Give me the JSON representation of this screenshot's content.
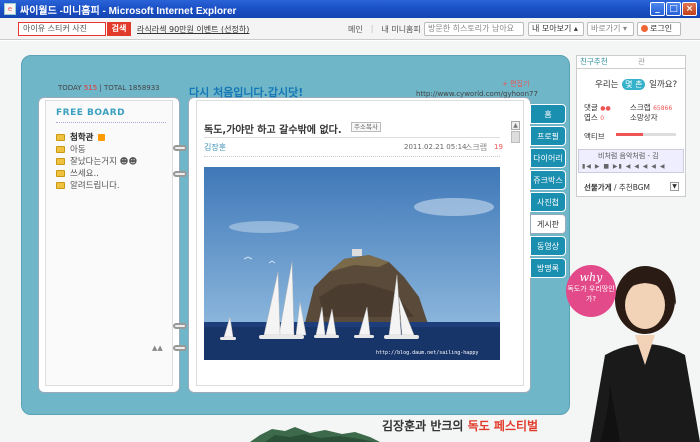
{
  "window": {
    "title": "싸이월드 -미니홈피 - Microsoft Internet Explorer",
    "controls": [
      "_",
      "□",
      "×"
    ]
  },
  "topbar": {
    "search_value": "아이유 스티커 사진",
    "search_button": "검색",
    "promo": "라식라섹 90만원 이벤트 (선정하)",
    "links": [
      "메인",
      "내 미니홈피"
    ],
    "history_button": "방문한 히스토리가 남아요",
    "more_button": "내 모아보기 ▴",
    "goto_button": "바로가기 ▾",
    "login_button": "로그인"
  },
  "visitor": {
    "today_label": "TODAY",
    "today": "515",
    "total_label": "TOTAL",
    "total": "1858933"
  },
  "board": {
    "title": "FREE BOARD",
    "items": [
      {
        "label": "첨학관",
        "new": true
      },
      {
        "label": "아동",
        "new": false
      },
      {
        "label": "잘났다는거지 ☻☻",
        "new": false
      },
      {
        "label": "쓰세요..",
        "new": false
      },
      {
        "label": "알려드립니다.",
        "new": false
      }
    ]
  },
  "header": {
    "greeting": "다시 처음입니다.갑시닷!",
    "edit_link": "+ 편집기",
    "url": "http://www.cyworld.com/gyhoon77"
  },
  "post": {
    "title": "독도,가야만 하고 갈수밖에 없다.",
    "copy_button": "주소복사",
    "author": "김장훈",
    "date": "2011.02.21 05:14",
    "scrap_label": "스크랩",
    "scrap_count": "19",
    "image_credit": "http://blog.daum.net/sailing-happy"
  },
  "tabs": [
    "홈",
    "프로필",
    "다이어리",
    "쥬크박스",
    "사진첩",
    "게시판",
    "동영상",
    "방명록"
  ],
  "active_tab": "게시판",
  "panel": {
    "tab_friend": "친구추천",
    "tab_other": "관",
    "friend_line_pre": "우리는",
    "friend_pill": "몇 촌",
    "friend_line_post": "일까요?",
    "comment_label": "댓글",
    "comment_value": "●●",
    "scrap_label": "스크랩",
    "scrap_value": "65866",
    "sticker_label": "엽스",
    "sticker_value": "0",
    "owner_label": "소망상자",
    "activity_label": "액티브",
    "activity_level": 0.45,
    "song": "비처럼 음악처럼 - 김",
    "player_controls": "▮◀ ▶ ■ ▶▮ ◀ ◀ ◀ ◀ ◀",
    "bgm_label": "선물가게",
    "bgm_suffix": "/ 추천BGM"
  },
  "ad": {
    "bubble_word": "why",
    "bubble_text": "독도가 우리땅인가?",
    "festival_pre": "김장훈과 반크의",
    "festival_highlight": "독도 페스티벌"
  }
}
